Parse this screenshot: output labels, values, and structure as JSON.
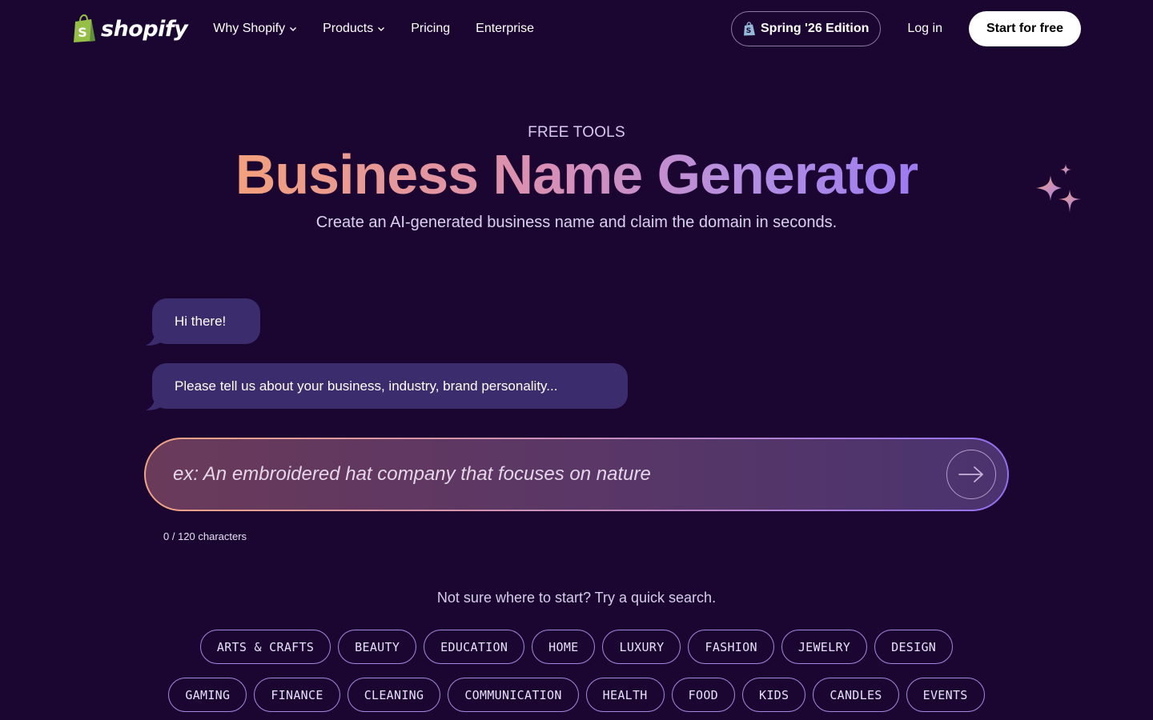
{
  "nav": {
    "logo_text": "shopify",
    "links": [
      {
        "label": "Why Shopify",
        "dropdown": true
      },
      {
        "label": "Products",
        "dropdown": true
      },
      {
        "label": "Pricing",
        "dropdown": false
      },
      {
        "label": "Enterprise",
        "dropdown": false
      }
    ],
    "edition_label": "Spring '26 Edition",
    "login_label": "Log in",
    "start_label": "Start for free"
  },
  "hero": {
    "eyebrow": "FREE TOOLS",
    "title": "Business Name Generator",
    "subtitle": "Create an AI-generated business name and claim the domain in seconds."
  },
  "chat": {
    "messages": [
      "Hi there!",
      "Please tell us about your business, industry, brand personality..."
    ]
  },
  "input": {
    "placeholder": "ex: An embroidered hat company that focuses on nature",
    "value": "",
    "char_count": "0 / 120 characters"
  },
  "quick_search": {
    "title": "Not sure where to start? Try a quick search.",
    "row1": [
      "ARTS & CRAFTS",
      "BEAUTY",
      "EDUCATION",
      "HOME",
      "LUXURY",
      "FASHION",
      "JEWELRY",
      "DESIGN"
    ],
    "row2": [
      "GAMING",
      "FINANCE",
      "CLEANING",
      "COMMUNICATION",
      "HEALTH",
      "FOOD",
      "KIDS",
      "CANDLES",
      "EVENTS"
    ]
  },
  "colors": {
    "background": "#1b0632",
    "bubble": "#3b2c6e",
    "chip_border": "#a28ae0",
    "logo_green": "#95bf47"
  },
  "icons": [
    "shopify-bag-icon",
    "chevron-down-icon",
    "shopify-bag-icon",
    "sparkles-icon",
    "arrow-right-icon"
  ]
}
